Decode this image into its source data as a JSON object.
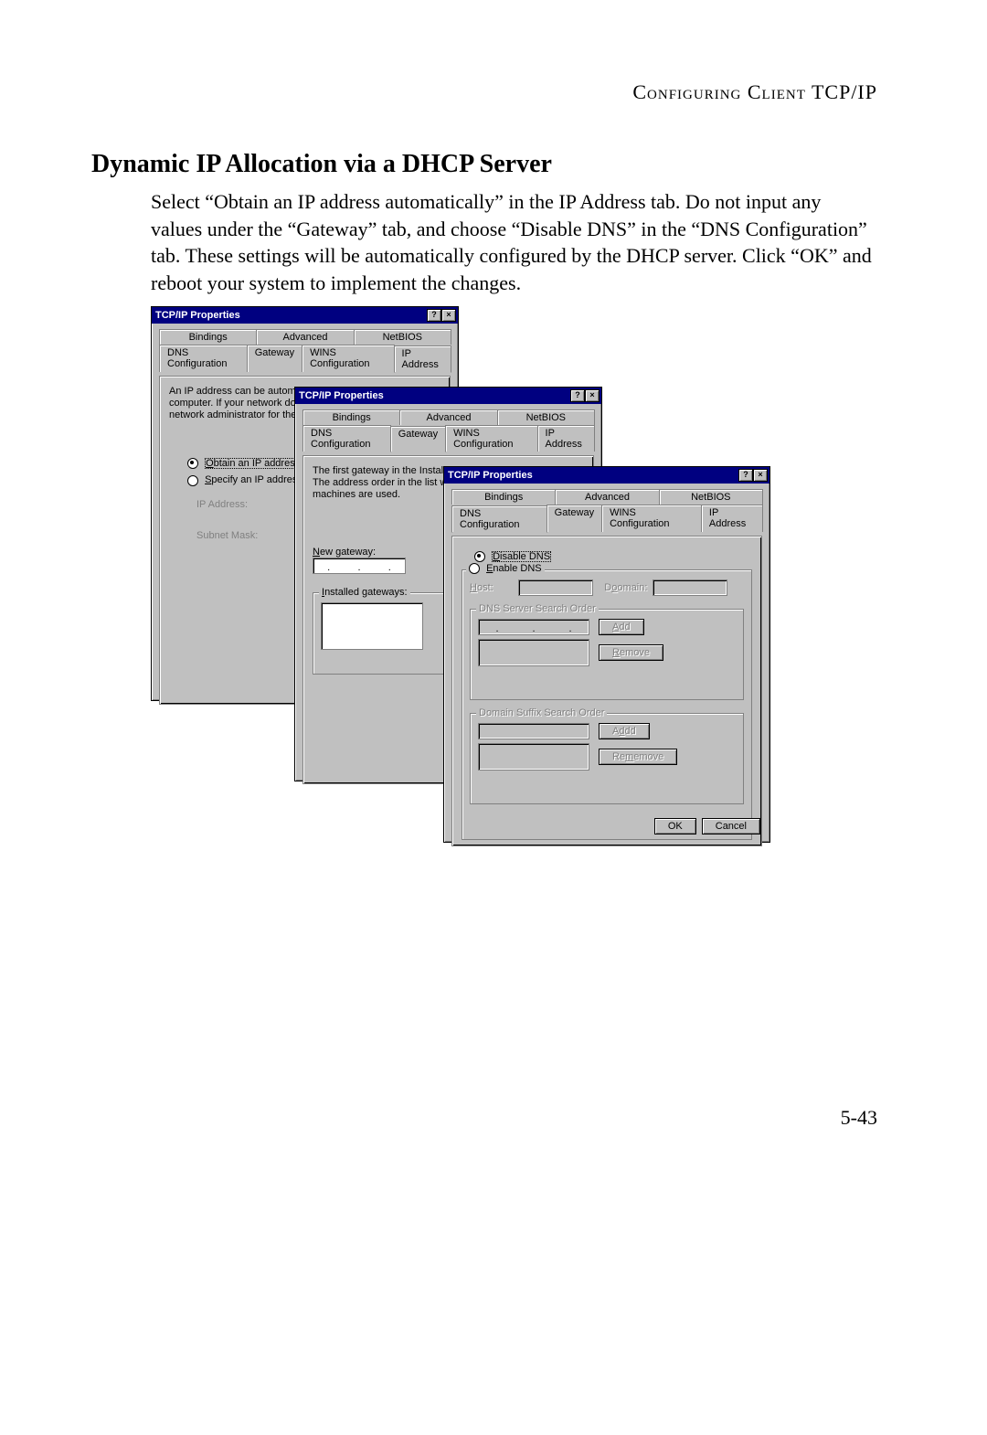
{
  "header": "Configuring Client TCP/IP",
  "title": "Dynamic IP Allocation via a DHCP Server",
  "body": "Select “Obtain an IP address automatically” in the IP Address tab. Do not input any values under the “Gateway” tab, and choose “Disable DNS” in the “DNS Configuration” tab. These settings will be automatically configured by the DHCP server. Click “OK” and reboot your system to implement the changes.",
  "page_number": "5-43",
  "dlg": {
    "title": "TCP/IP Properties",
    "caps": {
      "help": "?",
      "close": "×"
    },
    "tabs_top": [
      "Bindings",
      "Advanced",
      "NetBIOS"
    ],
    "tabs_bottom": [
      "DNS Configuration",
      "Gateway",
      "WINS Configuration",
      "IP Address"
    ]
  },
  "w1": {
    "info": "An IP address can be automatically assigned to this computer. If your network does not automatically your network administrator for the space below.",
    "r1": "Obtain an IP address au",
    "r2": "Specify an IP address:",
    "ip_lbl": "IP Address:",
    "mask_lbl": "Subnet Mask:"
  },
  "w2": {
    "info1": "The first gateway in the Install",
    "info2": "The address order in the list w",
    "info3": "machines are used.",
    "new_gw": "New gateway:",
    "installed_gw": "Installed gateways:"
  },
  "w3": {
    "disable": "Disable DNS",
    "enable": "Enable DNS",
    "host": "Host:",
    "domain": "Domain:",
    "search1": "DNS Server Search Order",
    "search2": "Domain Suffix Search Order",
    "add": "Add",
    "remove": "Remove",
    "ok": "OK",
    "cancel": "Cancel"
  }
}
